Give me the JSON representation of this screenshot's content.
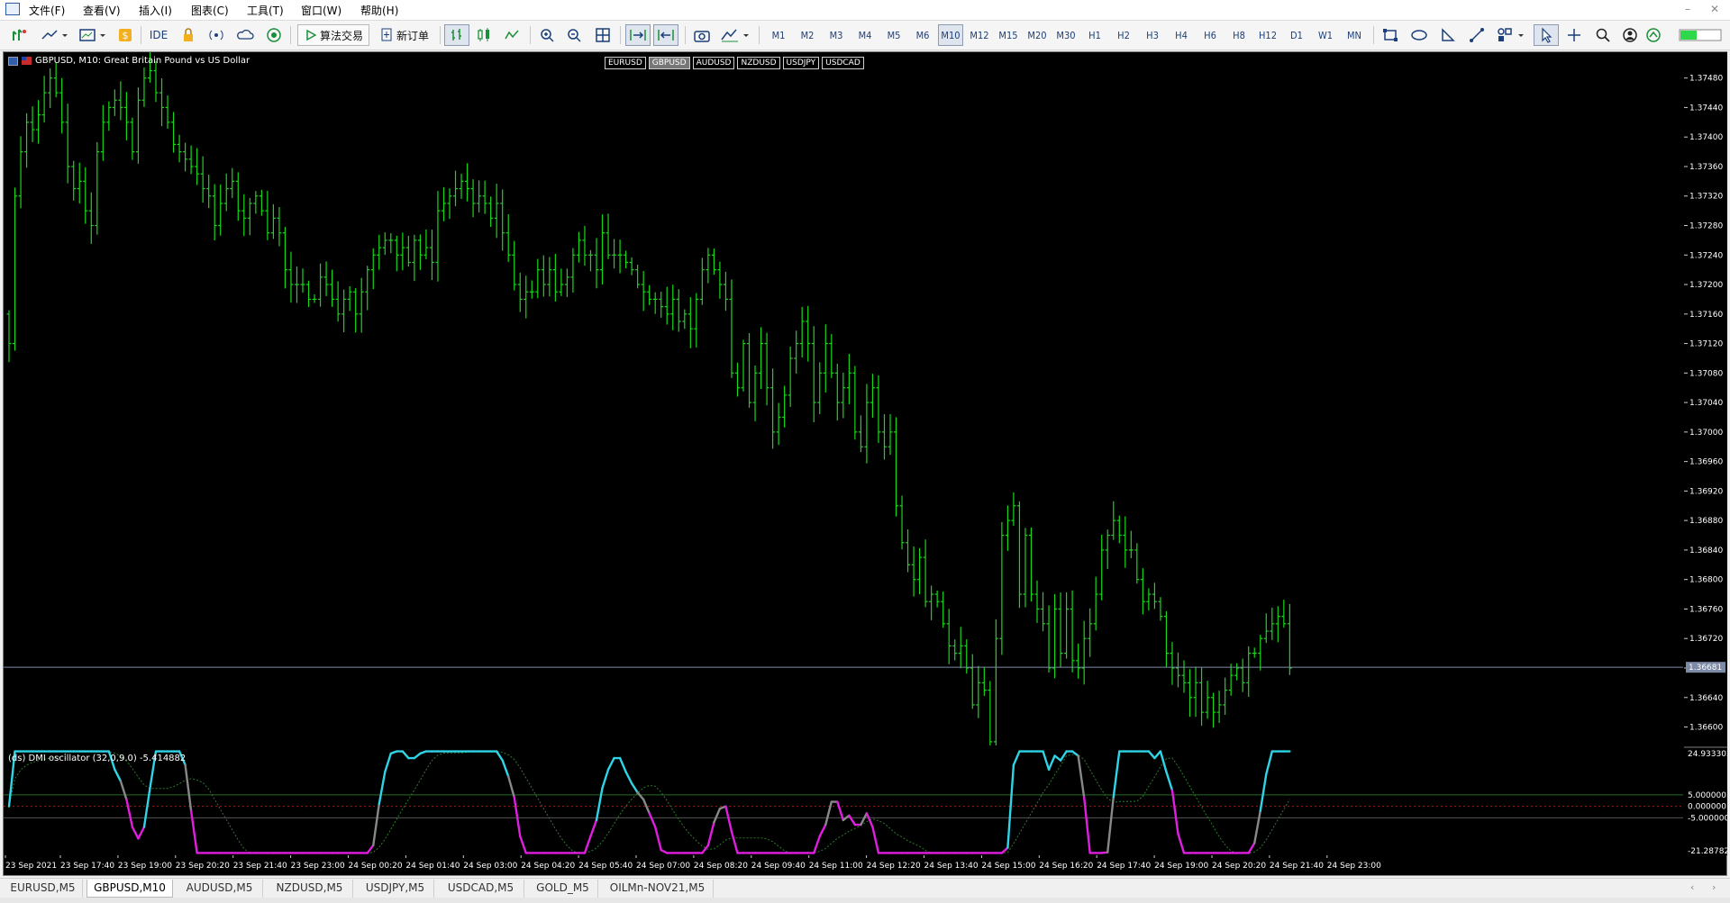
{
  "menu": [
    "文件(F)",
    "查看(V)",
    "插入(I)",
    "图表(C)",
    "工具(T)",
    "窗口(W)",
    "帮助(H)"
  ],
  "toolbar": {
    "ide_label": "IDE",
    "algo_label": "算法交易",
    "new_order_label": "新订单",
    "timeframes": [
      "M1",
      "M2",
      "M3",
      "M4",
      "M5",
      "M6",
      "M10",
      "M12",
      "M15",
      "M20",
      "M30",
      "H1",
      "H2",
      "H3",
      "H4",
      "H6",
      "H8",
      "H12",
      "D1",
      "W1",
      "MN"
    ],
    "active_timeframe": "M10"
  },
  "chart": {
    "title": "GBPUSD, M10:  Great Britain Pound vs US Dollar",
    "symbol_tabs": [
      "EURUSD",
      "GBPUSD",
      "AUDUSD",
      "NZDUSD",
      "USDJPY",
      "USDCAD"
    ],
    "active_symbol": "GBPUSD",
    "indicator_title": "(ds) DMI oscillator  (32,0,9.0)  -5.414882",
    "bar_color": "#19d619",
    "current_price_label": "1.36681",
    "price_ticks": [
      "1.37480",
      "1.37440",
      "1.37400",
      "1.37360",
      "1.37320",
      "1.37280",
      "1.37240",
      "1.37200",
      "1.37160",
      "1.37120",
      "1.37080",
      "1.37040",
      "1.37000",
      "1.36960",
      "1.36920",
      "1.36880",
      "1.36840",
      "1.36800",
      "1.36760",
      "1.36720",
      "1.36680",
      "1.36640",
      "1.36600"
    ],
    "indicator_ticks": [
      "24.933302",
      "5.000000",
      "0.000000",
      "-5.000000",
      "-21.287828"
    ],
    "time_labels": [
      "23 Sep 2021",
      "23 Sep 17:40",
      "23 Sep 19:00",
      "23 Sep 20:20",
      "23 Sep 21:40",
      "23 Sep 23:00",
      "24 Sep 00:20",
      "24 Sep 01:40",
      "24 Sep 03:00",
      "24 Sep 04:20",
      "24 Sep 05:40",
      "24 Sep 07:00",
      "24 Sep 08:20",
      "24 Sep 09:40",
      "24 Sep 11:00",
      "24 Sep 12:20",
      "24 Sep 13:40",
      "24 Sep 15:00",
      "24 Sep 16:20",
      "24 Sep 17:40",
      "24 Sep 19:00",
      "24 Sep 20:20",
      "24 Sep 21:40",
      "24 Sep 23:00"
    ]
  },
  "bottom_tabs": [
    "EURUSD,M5",
    "GBPUSD,M10",
    "AUDUSD,M5",
    "NZDUSD,M5",
    "USDJPY,M5",
    "USDCAD,M5",
    "GOLD_M5",
    "OILMn-NOV21,M5"
  ],
  "active_tab": "GBPUSD,M10",
  "chart_data": {
    "type": "ohlc",
    "title": "GBPUSD, M10:  Great Britain Pound vs US Dollar",
    "ylim": [
      1.36575,
      1.37515
    ],
    "closes": [
      1.3712,
      1.3732,
      1.3738,
      1.3742,
      1.3741,
      1.3743,
      1.3746,
      1.3748,
      1.3746,
      1.3742,
      1.3736,
      1.3733,
      1.3734,
      1.373,
      1.3728,
      1.3738,
      1.3742,
      1.3744,
      1.3745,
      1.3744,
      1.3742,
      1.3738,
      1.3745,
      1.3748,
      1.3749,
      1.3746,
      1.3744,
      1.3742,
      1.3739,
      1.3738,
      1.3737,
      1.3736,
      1.3735,
      1.3733,
      1.3732,
      1.3728,
      1.3731,
      1.3733,
      1.3734,
      1.373,
      1.3729,
      1.3731,
      1.3732,
      1.373,
      1.3727,
      1.3729,
      1.3727,
      1.3722,
      1.372,
      1.372,
      1.372,
      1.3718,
      1.3718,
      1.3721,
      1.372,
      1.3718,
      1.3716,
      1.3718,
      1.3719,
      1.3716,
      1.3719,
      1.3722,
      1.3724,
      1.3725,
      1.3726,
      1.3726,
      1.3724,
      1.3725,
      1.3723,
      1.3726,
      1.3724,
      1.3725,
      1.3723,
      1.373,
      1.3731,
      1.3732,
      1.3733,
      1.3734,
      1.3733,
      1.3731,
      1.3732,
      1.3731,
      1.3729,
      1.3731,
      1.3727,
      1.3724,
      1.372,
      1.3718,
      1.3719,
      1.3719,
      1.3722,
      1.372,
      1.3722,
      1.3719,
      1.372,
      1.3721,
      1.3724,
      1.3726,
      1.3724,
      1.3724,
      1.3722,
      1.3727,
      1.3724,
      1.3724,
      1.3724,
      1.3723,
      1.3722,
      1.372,
      1.3719,
      1.3718,
      1.3718,
      1.3717,
      1.3716,
      1.3718,
      1.3715,
      1.3716,
      1.3714,
      1.3718,
      1.3722,
      1.3724,
      1.3722,
      1.372,
      1.3718,
      1.3708,
      1.3706,
      1.3712,
      1.3704,
      1.3708,
      1.3712,
      1.3706,
      1.37,
      1.3702,
      1.3705,
      1.371,
      1.3712,
      1.3715,
      1.3712,
      1.3704,
      1.3708,
      1.3712,
      1.3708,
      1.3704,
      1.3706,
      1.3708,
      1.37,
      1.3698,
      1.3704,
      1.3706,
      1.37,
      1.3698,
      1.37,
      1.369,
      1.3685,
      1.3682,
      1.368,
      1.3683,
      1.3677,
      1.3678,
      1.3677,
      1.3674,
      1.3671,
      1.367,
      1.3671,
      1.3668,
      1.3663,
      1.3666,
      1.3665,
      1.3658,
      1.3672,
      1.3686,
      1.3688,
      1.369,
      1.3678,
      1.3686,
      1.3678,
      1.3676,
      1.3674,
      1.3668,
      1.3676,
      1.367,
      1.3676,
      1.3669,
      1.3668,
      1.3672,
      1.3674,
      1.3678,
      1.3684,
      1.3686,
      1.3688,
      1.3686,
      1.3684,
      1.3684,
      1.368,
      1.3677,
      1.3678,
      1.3677,
      1.3675,
      1.367,
      1.3668,
      1.3667,
      1.3666,
      1.3664,
      1.3666,
      1.3662,
      1.3664,
      1.3662,
      1.3663,
      1.3665,
      1.3667,
      1.3668,
      1.3666,
      1.367,
      1.367,
      1.3672,
      1.3673,
      1.3674,
      1.3675,
      1.3674,
      1.3668
    ]
  }
}
